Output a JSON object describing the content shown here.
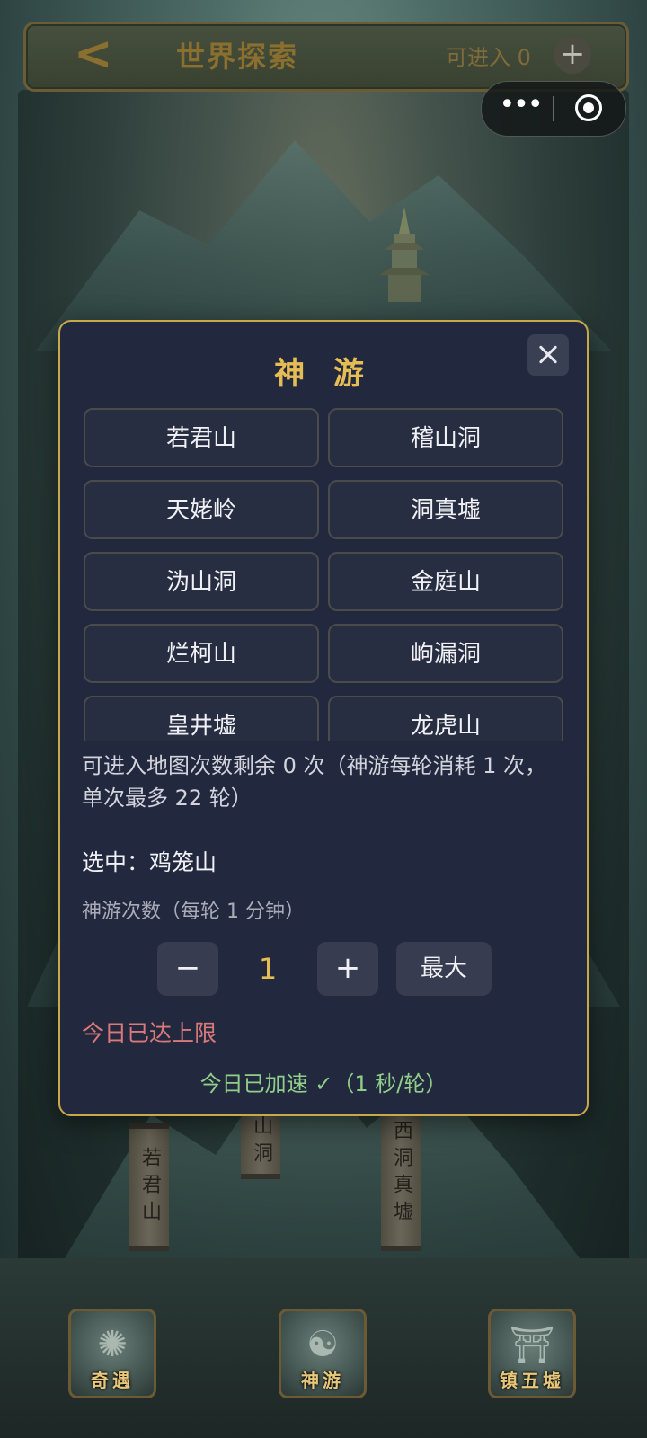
{
  "header": {
    "back_icon": "chevron-left-icon",
    "title": "世界探索",
    "entry_count_label": "可进入 0",
    "add_icon": "plus-icon"
  },
  "capsule": {
    "more_icon": "more-dots-icon",
    "close_icon": "record-circle-icon"
  },
  "background_scrolls": [
    "若君山",
    "山洞",
    "西洞真墟"
  ],
  "modal": {
    "title": "神 游",
    "close_icon": "close-icon",
    "maps": [
      "若君山",
      "稽山洞",
      "天姥岭",
      "洞真墟",
      "沩山洞",
      "金庭山",
      "烂柯山",
      "岣漏洞",
      "皇井墟",
      "龙虎山"
    ],
    "info": "可进入地图次数剩余 0 次（神游每轮消耗 1 次，单次最多 22 轮）",
    "selected": "选中：鸡笼山",
    "count_label": "神游次数（每轮 1 分钟）",
    "minus_label": "−",
    "count_value": "1",
    "plus_label": "+",
    "max_label": "最大",
    "limit_text": "今日已达上限",
    "speed_text": "今日已加速 ✓（1 秒/轮）"
  },
  "bottom_nav": [
    {
      "label": "奇遇",
      "icon": "adventure-icon"
    },
    {
      "label": "神游",
      "icon": "meditation-icon"
    },
    {
      "label": "镇五墟",
      "icon": "pagoda-icon"
    }
  ],
  "colors": {
    "modal_bg": "#22283d",
    "modal_border": "#c9a84a",
    "title_gold": "#e6bd55",
    "limit_red": "#d9797b",
    "speed_green": "#8fcf8a"
  }
}
